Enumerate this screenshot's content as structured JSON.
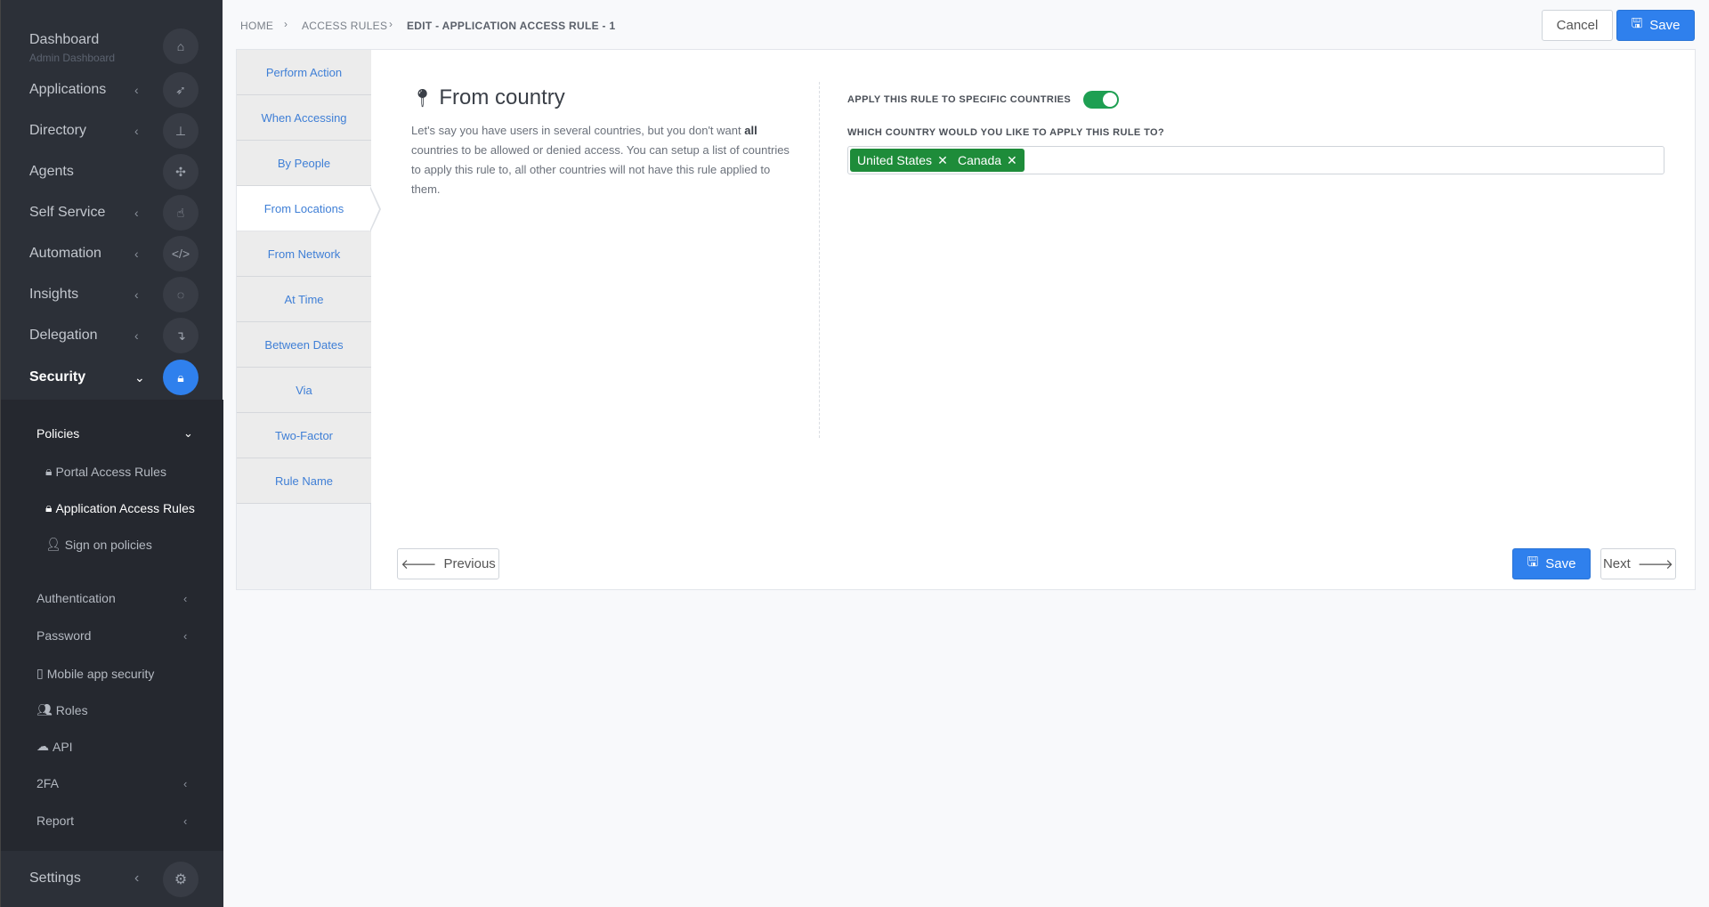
{
  "sidebar": {
    "items": [
      {
        "label": "Dashboard",
        "sub": "Admin Dashboard",
        "icon": "home-icon"
      },
      {
        "label": "Applications",
        "icon": "rocket-icon"
      },
      {
        "label": "Directory",
        "icon": "sitemap-icon"
      },
      {
        "label": "Agents",
        "icon": "agents-icon"
      },
      {
        "label": "Self Service",
        "icon": "hand-pointer-icon"
      },
      {
        "label": "Automation",
        "icon": "code-icon"
      },
      {
        "label": "Insights",
        "icon": "lightbulb-icon"
      },
      {
        "label": "Delegation",
        "icon": "delegation-icon"
      },
      {
        "label": "Security",
        "icon": "lock-icon"
      }
    ],
    "security_sub": {
      "policies": "Policies",
      "portal_access_rules": "Portal Access Rules",
      "application_access_rules": "Application Access Rules",
      "sign_on_policies": "Sign on policies",
      "authentication": "Authentication",
      "password": "Password",
      "mobile_app_security": "Mobile app security",
      "roles": "Roles",
      "api": "API",
      "twofa": "2FA",
      "report": "Report"
    },
    "settings": "Settings"
  },
  "breadcrumb": {
    "home": "HOME",
    "access_rules": "ACCESS RULES",
    "current": "EDIT - APPLICATION ACCESS RULE - 1"
  },
  "toolbar": {
    "cancel": "Cancel",
    "save": "Save"
  },
  "tabs": [
    "Perform Action",
    "When Accessing",
    "By People",
    "From Locations",
    "From Network",
    "At Time",
    "Between Dates",
    "Via",
    "Two-Factor",
    "Rule Name"
  ],
  "active_tab": "From Locations",
  "section": {
    "title": "From country",
    "desc_before": "Let's say you have users in several countries, but you don't want ",
    "desc_bold": "all",
    "desc_after": " countries to be allowed or denied access. You can setup a list of countries to apply this rule to, all other countries will not have this rule applied to them.",
    "toggle_label": "APPLY THIS RULE TO SPECIFIC COUNTRIES",
    "toggle_on": true,
    "country_label": "WHICH COUNTRY WOULD YOU LIKE TO APPLY THIS RULE TO?",
    "countries": [
      "United States",
      "Canada"
    ]
  },
  "footer": {
    "previous": "Previous",
    "save": "Save",
    "next": "Next"
  },
  "colors": {
    "primary": "#2f80ed",
    "tag": "#1e8c3a",
    "toggle": "#1e9f52",
    "sidebar": "#2c3038"
  }
}
